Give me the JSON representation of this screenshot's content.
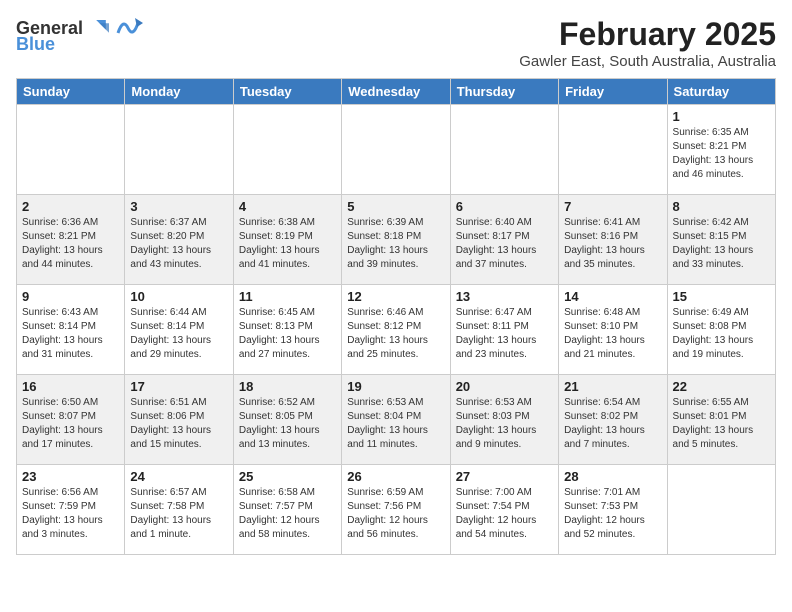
{
  "header": {
    "logo_general": "General",
    "logo_blue": "Blue",
    "month": "February 2025",
    "location": "Gawler East, South Australia, Australia"
  },
  "days_of_week": [
    "Sunday",
    "Monday",
    "Tuesday",
    "Wednesday",
    "Thursday",
    "Friday",
    "Saturday"
  ],
  "weeks": [
    [
      {
        "day": "",
        "info": ""
      },
      {
        "day": "",
        "info": ""
      },
      {
        "day": "",
        "info": ""
      },
      {
        "day": "",
        "info": ""
      },
      {
        "day": "",
        "info": ""
      },
      {
        "day": "",
        "info": ""
      },
      {
        "day": "1",
        "info": "Sunrise: 6:35 AM\nSunset: 8:21 PM\nDaylight: 13 hours\nand 46 minutes."
      }
    ],
    [
      {
        "day": "2",
        "info": "Sunrise: 6:36 AM\nSunset: 8:21 PM\nDaylight: 13 hours\nand 44 minutes."
      },
      {
        "day": "3",
        "info": "Sunrise: 6:37 AM\nSunset: 8:20 PM\nDaylight: 13 hours\nand 43 minutes."
      },
      {
        "day": "4",
        "info": "Sunrise: 6:38 AM\nSunset: 8:19 PM\nDaylight: 13 hours\nand 41 minutes."
      },
      {
        "day": "5",
        "info": "Sunrise: 6:39 AM\nSunset: 8:18 PM\nDaylight: 13 hours\nand 39 minutes."
      },
      {
        "day": "6",
        "info": "Sunrise: 6:40 AM\nSunset: 8:17 PM\nDaylight: 13 hours\nand 37 minutes."
      },
      {
        "day": "7",
        "info": "Sunrise: 6:41 AM\nSunset: 8:16 PM\nDaylight: 13 hours\nand 35 minutes."
      },
      {
        "day": "8",
        "info": "Sunrise: 6:42 AM\nSunset: 8:15 PM\nDaylight: 13 hours\nand 33 minutes."
      }
    ],
    [
      {
        "day": "9",
        "info": "Sunrise: 6:43 AM\nSunset: 8:14 PM\nDaylight: 13 hours\nand 31 minutes."
      },
      {
        "day": "10",
        "info": "Sunrise: 6:44 AM\nSunset: 8:14 PM\nDaylight: 13 hours\nand 29 minutes."
      },
      {
        "day": "11",
        "info": "Sunrise: 6:45 AM\nSunset: 8:13 PM\nDaylight: 13 hours\nand 27 minutes."
      },
      {
        "day": "12",
        "info": "Sunrise: 6:46 AM\nSunset: 8:12 PM\nDaylight: 13 hours\nand 25 minutes."
      },
      {
        "day": "13",
        "info": "Sunrise: 6:47 AM\nSunset: 8:11 PM\nDaylight: 13 hours\nand 23 minutes."
      },
      {
        "day": "14",
        "info": "Sunrise: 6:48 AM\nSunset: 8:10 PM\nDaylight: 13 hours\nand 21 minutes."
      },
      {
        "day": "15",
        "info": "Sunrise: 6:49 AM\nSunset: 8:08 PM\nDaylight: 13 hours\nand 19 minutes."
      }
    ],
    [
      {
        "day": "16",
        "info": "Sunrise: 6:50 AM\nSunset: 8:07 PM\nDaylight: 13 hours\nand 17 minutes."
      },
      {
        "day": "17",
        "info": "Sunrise: 6:51 AM\nSunset: 8:06 PM\nDaylight: 13 hours\nand 15 minutes."
      },
      {
        "day": "18",
        "info": "Sunrise: 6:52 AM\nSunset: 8:05 PM\nDaylight: 13 hours\nand 13 minutes."
      },
      {
        "day": "19",
        "info": "Sunrise: 6:53 AM\nSunset: 8:04 PM\nDaylight: 13 hours\nand 11 minutes."
      },
      {
        "day": "20",
        "info": "Sunrise: 6:53 AM\nSunset: 8:03 PM\nDaylight: 13 hours\nand 9 minutes."
      },
      {
        "day": "21",
        "info": "Sunrise: 6:54 AM\nSunset: 8:02 PM\nDaylight: 13 hours\nand 7 minutes."
      },
      {
        "day": "22",
        "info": "Sunrise: 6:55 AM\nSunset: 8:01 PM\nDaylight: 13 hours\nand 5 minutes."
      }
    ],
    [
      {
        "day": "23",
        "info": "Sunrise: 6:56 AM\nSunset: 7:59 PM\nDaylight: 13 hours\nand 3 minutes."
      },
      {
        "day": "24",
        "info": "Sunrise: 6:57 AM\nSunset: 7:58 PM\nDaylight: 13 hours\nand 1 minute."
      },
      {
        "day": "25",
        "info": "Sunrise: 6:58 AM\nSunset: 7:57 PM\nDaylight: 12 hours\nand 58 minutes."
      },
      {
        "day": "26",
        "info": "Sunrise: 6:59 AM\nSunset: 7:56 PM\nDaylight: 12 hours\nand 56 minutes."
      },
      {
        "day": "27",
        "info": "Sunrise: 7:00 AM\nSunset: 7:54 PM\nDaylight: 12 hours\nand 54 minutes."
      },
      {
        "day": "28",
        "info": "Sunrise: 7:01 AM\nSunset: 7:53 PM\nDaylight: 12 hours\nand 52 minutes."
      },
      {
        "day": "",
        "info": ""
      }
    ]
  ]
}
